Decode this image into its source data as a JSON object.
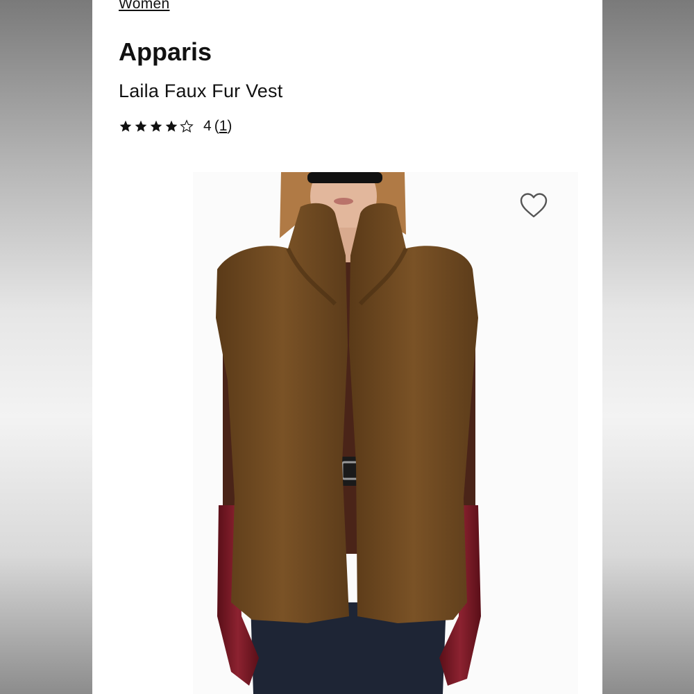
{
  "breadcrumb": "Women",
  "product": {
    "brand": "Apparis",
    "name": "Laila Faux Fur Vest",
    "rating": 4,
    "rating_value_label": "4",
    "review_count": "1",
    "star_icon": "star-icon",
    "favorite_icon": "heart-outline-icon"
  },
  "colors": {
    "fur": "#6e4a22",
    "glove": "#7a1a22",
    "jeans": "#1e2535"
  }
}
